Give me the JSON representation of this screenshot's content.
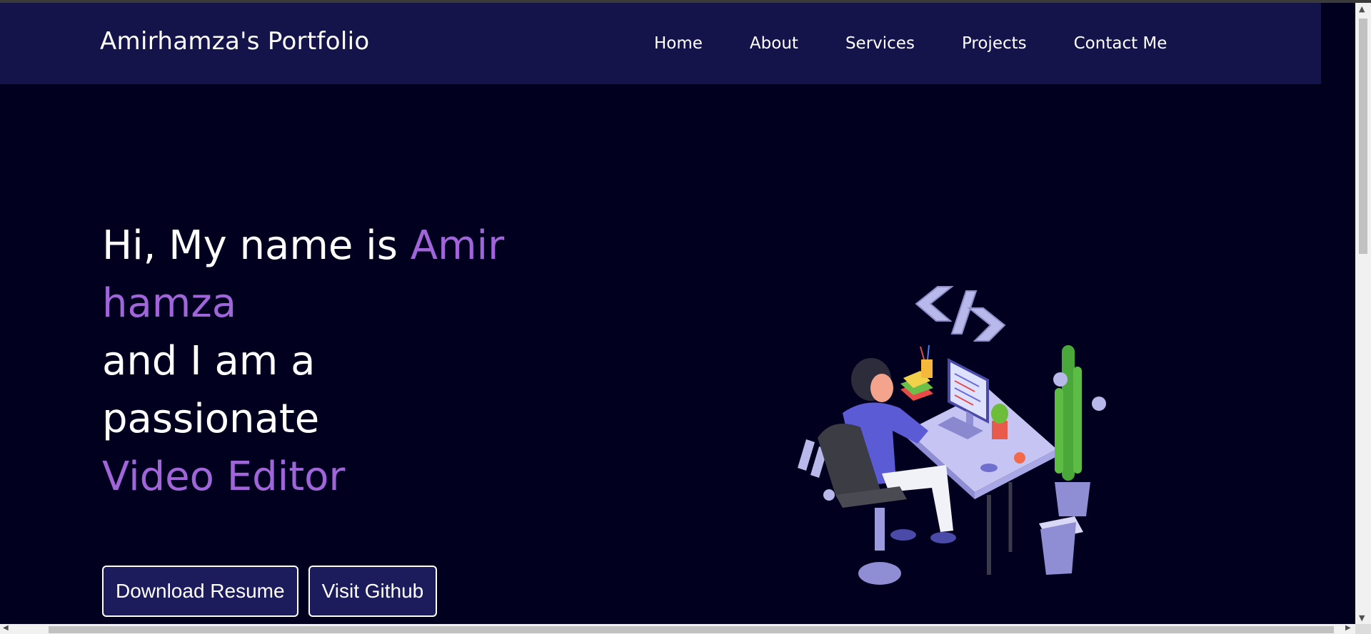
{
  "nav": {
    "brand": "Amirhamza's Portfolio",
    "links": [
      "Home",
      "About",
      "Services",
      "Projects",
      "Contact Me"
    ]
  },
  "hero": {
    "greeting": "Hi, My name is ",
    "name_first": "Amir",
    "name_last": "hamza",
    "line_and": "and I am a",
    "line_passion": "passionate",
    "role": "Video Editor"
  },
  "buttons": {
    "resume": "Download Resume",
    "github": "Visit Github"
  },
  "colors": {
    "background": "#02001f",
    "navbar": "#14134a",
    "accent": "#a066d9",
    "button": "#1c1b5c"
  },
  "illustration": {
    "icon": "developer-at-desk-illustration"
  }
}
